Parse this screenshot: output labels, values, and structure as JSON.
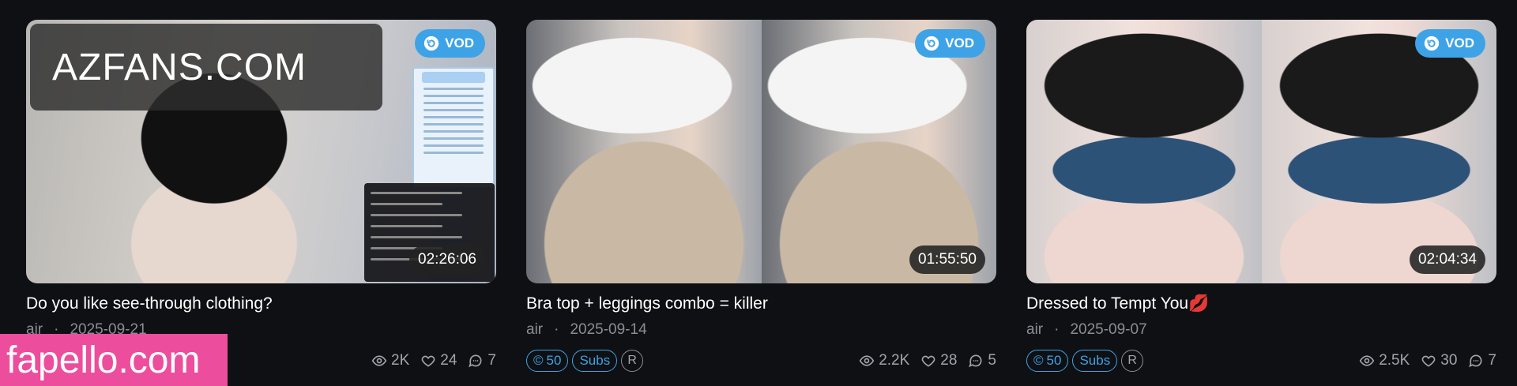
{
  "cards": [
    {
      "title": "Do you like see-through clothing?",
      "author": "air",
      "date": "2025-09-21",
      "vod_label": "VOD",
      "duration": "02:26:06",
      "views": "2K",
      "likes": "24",
      "comments": "7",
      "watermark": "AZFANS.COM"
    },
    {
      "title": "Bra top + leggings combo = killer",
      "author": "air",
      "date": "2025-09-14",
      "vod_label": "VOD",
      "duration": "01:55:50",
      "price": "50",
      "subs_label": "Subs",
      "rating": "R",
      "views": "2.2K",
      "likes": "28",
      "comments": "5"
    },
    {
      "title": "Dressed to Tempt You💋",
      "author": "air",
      "date": "2025-09-07",
      "vod_label": "VOD",
      "duration": "02:04:34",
      "price": "50",
      "subs_label": "Subs",
      "rating": "R",
      "views": "2.5K",
      "likes": "30",
      "comments": "7"
    }
  ],
  "site_watermark": "fapello.com",
  "icons": {
    "vod": "replay-icon",
    "views": "eye-icon",
    "likes": "heart-icon",
    "comments": "comment-icon",
    "price": "coin-icon"
  },
  "colors": {
    "accent": "#3ea2e6",
    "background": "#0f1013",
    "muted": "#8c8d93",
    "watermark_bg": "#ec4d9c"
  }
}
